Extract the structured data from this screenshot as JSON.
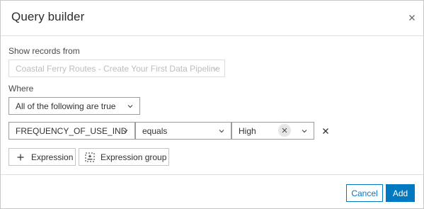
{
  "dialog": {
    "title": "Query builder"
  },
  "source": {
    "label": "Show records from",
    "value": "Coastal Ferry Routes - Create Your First Data Pipeline"
  },
  "where": {
    "label": "Where",
    "mode": "All of the following are true"
  },
  "expression": {
    "field": "FREQUENCY_OF_USE_IND",
    "operator": "equals",
    "value": "High"
  },
  "buttons": {
    "add_expression": "Expression",
    "add_expression_group": "Expression group",
    "cancel": "Cancel",
    "add": "Add"
  },
  "colors": {
    "brand": "#0079c1"
  }
}
